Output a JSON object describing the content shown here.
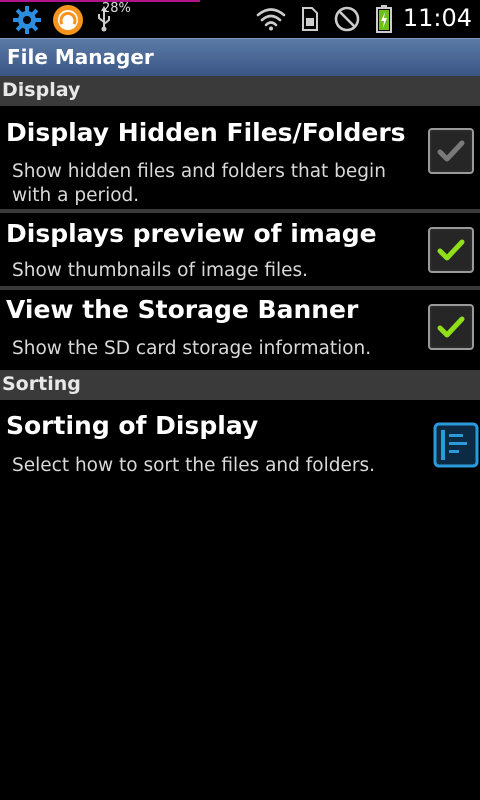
{
  "status_bar": {
    "battery_percent": "28%",
    "time": "11:04",
    "icons": [
      "gear-icon",
      "app-icon",
      "usb-icon",
      "wifi-icon",
      "sim-icon",
      "block-icon",
      "battery-icon"
    ]
  },
  "app": {
    "title": "File Manager"
  },
  "sections": {
    "display": {
      "label": "Display",
      "items": [
        {
          "title": "Display Hidden Files/Folders",
          "summary": "Show hidden files and folders that begin with a period.",
          "checked": false
        },
        {
          "title": "Displays preview of image",
          "summary": "Show thumbnails of image files.",
          "checked": true
        },
        {
          "title": "View the Storage Banner",
          "summary": "Show the SD card storage information.",
          "checked": true
        }
      ]
    },
    "sorting": {
      "label": "Sorting",
      "items": [
        {
          "title": "Sorting of Display",
          "summary": "Select how to sort the files and folders.",
          "icon": "list-icon"
        }
      ]
    }
  },
  "colors": {
    "accent_check": "#8fe01a",
    "title_bar": "#4a6797",
    "section_header": "#3a3a3a",
    "list_icon": "#2a9ad8"
  }
}
